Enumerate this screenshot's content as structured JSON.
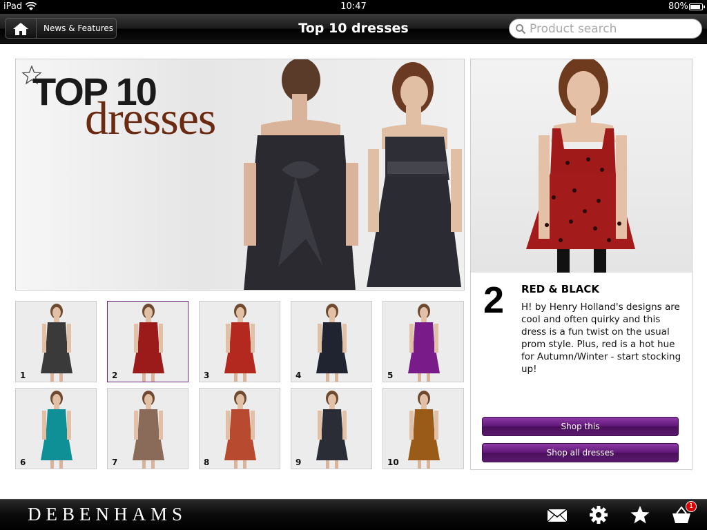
{
  "status_bar": {
    "device": "iPad",
    "time": "10:47",
    "battery": "80%"
  },
  "nav": {
    "back_label": "News & Features",
    "title": "Top 10 dresses",
    "search_placeholder": "Product search"
  },
  "hero": {
    "title_line1": "TOP 10",
    "title_line2": "dresses"
  },
  "thumbnails": [
    {
      "number": "1",
      "dress_color": "#3a3a3a"
    },
    {
      "number": "2",
      "dress_color": "#9b1b1b"
    },
    {
      "number": "3",
      "dress_color": "#b3291f"
    },
    {
      "number": "4",
      "dress_color": "#1f2430"
    },
    {
      "number": "5",
      "dress_color": "#7a1b8a"
    },
    {
      "number": "6",
      "dress_color": "#0f8f96"
    },
    {
      "number": "7",
      "dress_color": "#8a6a58"
    },
    {
      "number": "8",
      "dress_color": "#b84a30"
    },
    {
      "number": "9",
      "dress_color": "#2a2d36"
    },
    {
      "number": "10",
      "dress_color": "#9a5a18"
    }
  ],
  "selected_index": 1,
  "detail": {
    "number": "2",
    "name": "RED & BLACK",
    "description": "H! by Henry Holland's designs are cool and often quirky and this dress is a fun twist on the usual prom style. Plus, red is a hot hue for Autumn/Winter - start stocking up!",
    "shop_this_label": "Shop this",
    "shop_all_label": "Shop all dresses"
  },
  "footer": {
    "logo": "DEBENHAMS",
    "basket_count": "1"
  },
  "colors": {
    "accent_purple": "#5e1774",
    "selected_border": "#6a2280"
  }
}
